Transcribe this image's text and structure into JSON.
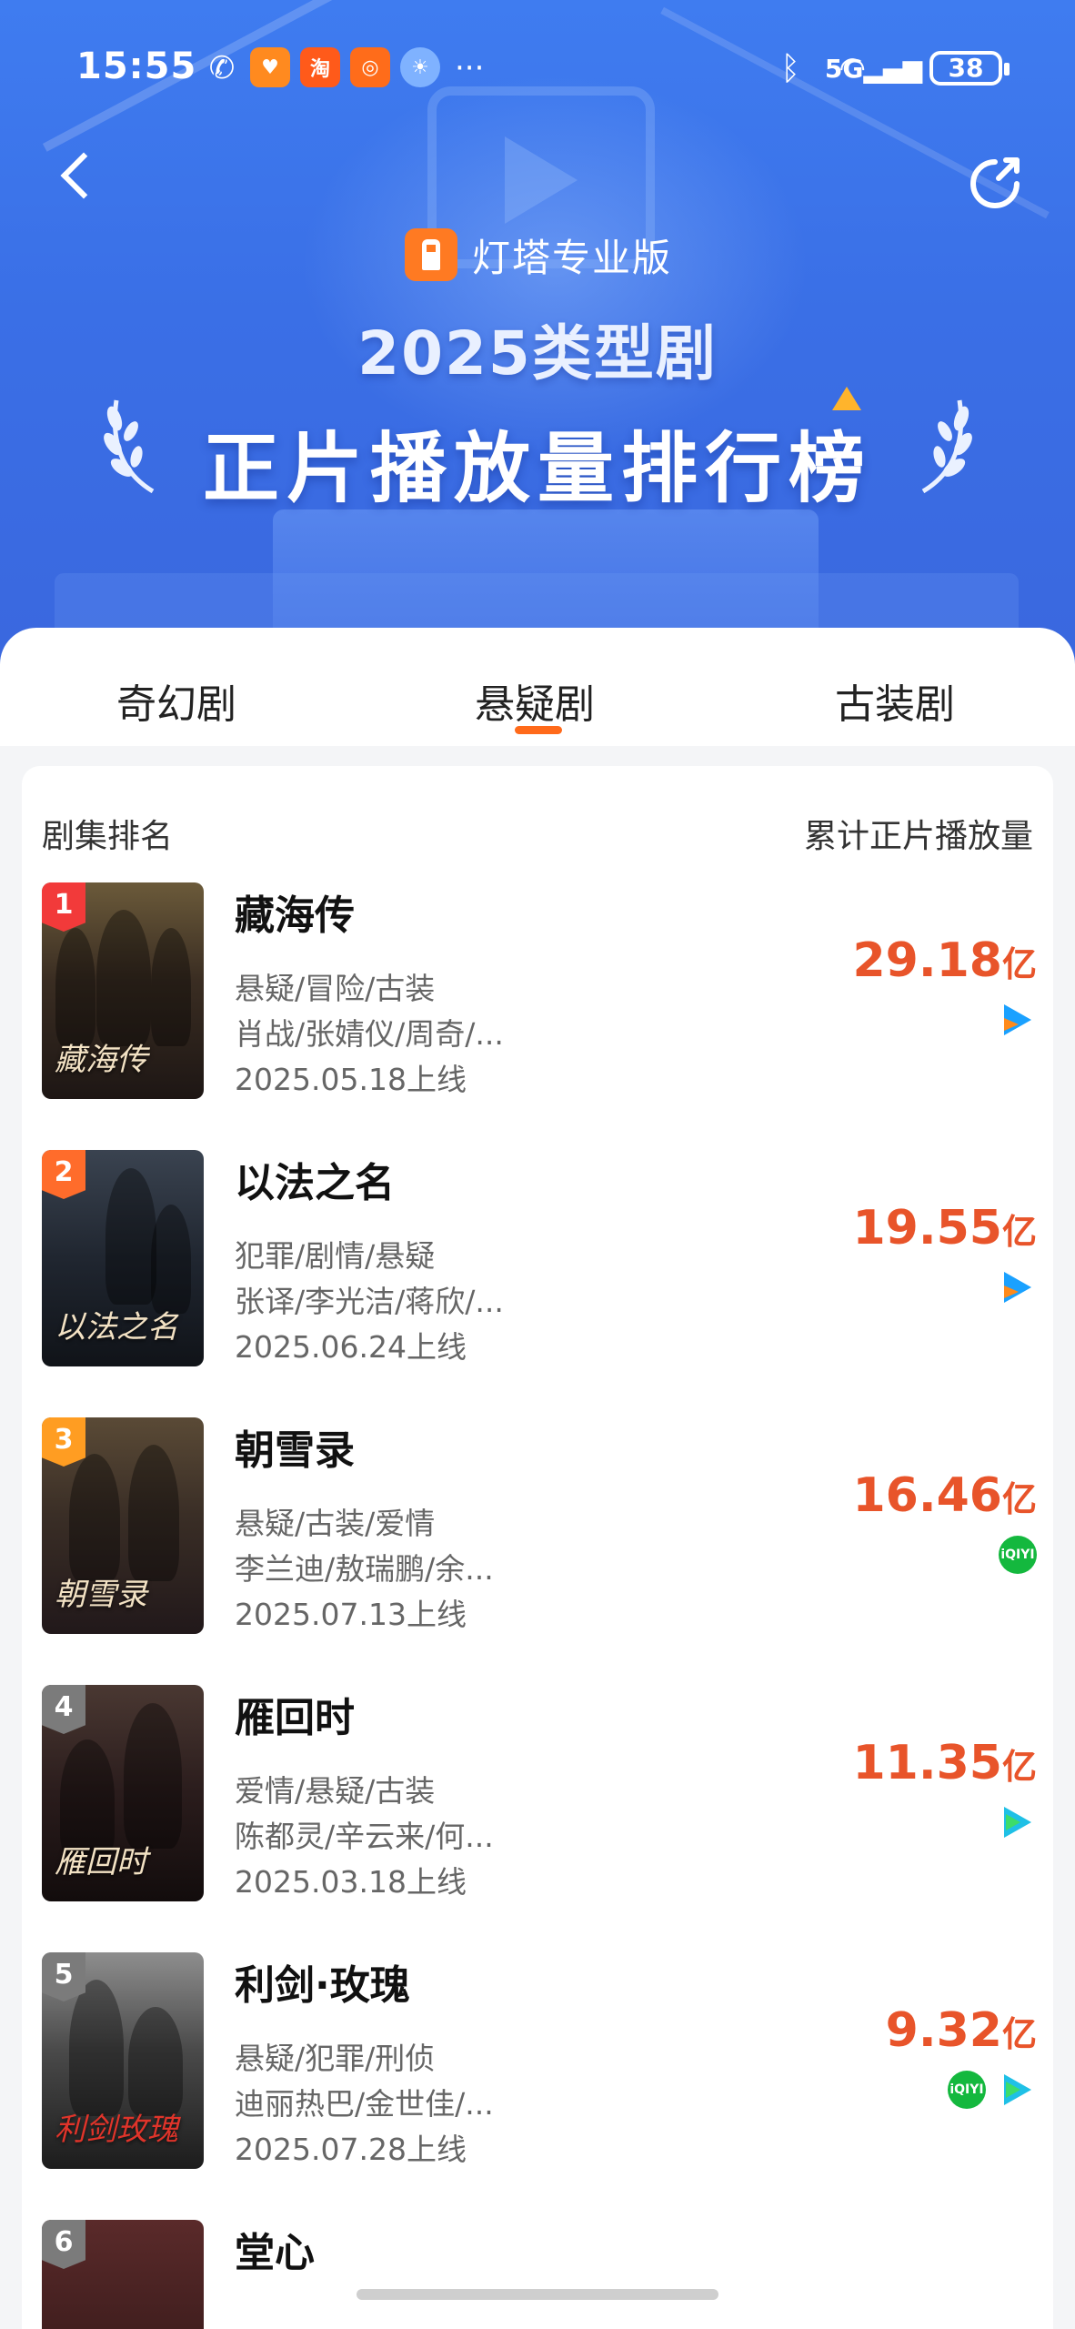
{
  "status_bar": {
    "time": "15:55",
    "app_icons": [
      "missed-call-icon",
      "shield-app-icon",
      "taobao-icon",
      "app-icon",
      "weather-icon"
    ],
    "taobao_label": "淘",
    "more": "···",
    "network": "5G",
    "battery": "38"
  },
  "header": {
    "brand": "灯塔专业版",
    "title_line1": "2025类型剧",
    "title_line2": "正片播放量排行榜"
  },
  "tabs": [
    {
      "label": "奇幻剧",
      "active": false
    },
    {
      "label": "悬疑剧",
      "active": true
    },
    {
      "label": "古装剧",
      "active": false
    }
  ],
  "table": {
    "col_left": "剧集排名",
    "col_right": "累计正片播放量",
    "unit": "亿",
    "rows": [
      {
        "rank": "1",
        "name": "藏海传",
        "genres": "悬疑/冒险/古装",
        "cast": "肖战/张婧仪/周奇/...",
        "date": "2025.05.18上线",
        "value": "29.18",
        "poster_text": "藏海传",
        "platforms": [
          "tencent-video"
        ]
      },
      {
        "rank": "2",
        "name": "以法之名",
        "genres": "犯罪/剧情/悬疑",
        "cast": "张译/李光洁/蒋欣/...",
        "date": "2025.06.24上线",
        "value": "19.55",
        "poster_text": "以法之名",
        "platforms": [
          "tencent-video"
        ]
      },
      {
        "rank": "3",
        "name": "朝雪录",
        "genres": "悬疑/古装/爱情",
        "cast": "李兰迪/敖瑞鹏/余...",
        "date": "2025.07.13上线",
        "value": "16.46",
        "poster_text": "朝雪录",
        "platforms": [
          "iqiyi"
        ]
      },
      {
        "rank": "4",
        "name": "雁回时",
        "genres": "爱情/悬疑/古装",
        "cast": "陈都灵/辛云来/何...",
        "date": "2025.03.18上线",
        "value": "11.35",
        "poster_text": "雁回时",
        "platforms": [
          "youku"
        ]
      },
      {
        "rank": "5",
        "name": "利剑·玫瑰",
        "genres": "悬疑/犯罪/刑侦",
        "cast": "迪丽热巴/金世佳/...",
        "date": "2025.07.28上线",
        "value": "9.32",
        "poster_text": "利剑玫瑰",
        "platforms": [
          "iqiyi",
          "youku"
        ]
      },
      {
        "rank": "6",
        "name": "堂心"
      }
    ],
    "iqiyi_label": "iQIYI"
  }
}
